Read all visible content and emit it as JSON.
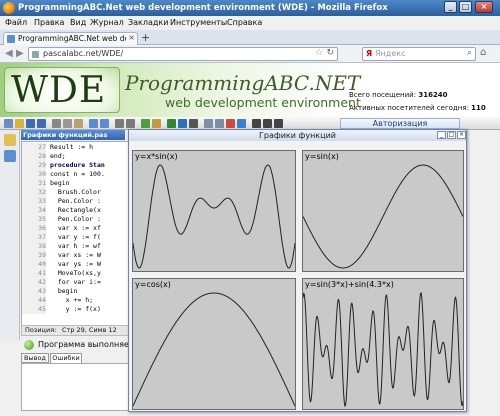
{
  "browser": {
    "title": "ProgrammingABC.Net web development environment (WDE) - Mozilla Firefox",
    "menu": [
      "Файл",
      "Правка",
      "Вид",
      "Журнал",
      "Закладки",
      "Инструменты",
      "Справка"
    ],
    "tab_title": "ProgrammingABC.Net web develo...",
    "new_tab": "+",
    "url": "pascalabc.net/WDE/",
    "search_engine": "Яндекс"
  },
  "header": {
    "logo": "WDE",
    "brand": "ProgrammingABC.NET",
    "subbrand": "web development environment",
    "visits_label": "Всего посещений:",
    "visits_value": "316240",
    "active_label": "Активных посетителей сегодня:",
    "active_value": "110"
  },
  "ide": {
    "file_tab": "Графики функций.pas",
    "auth_button": "Авторизация",
    "code_lines": [
      {
        "n": "27",
        "t": "Result := h",
        "bold": false
      },
      {
        "n": "28",
        "t": "end;",
        "bold": false
      },
      {
        "n": "29",
        "t": "procedure Stan",
        "bold": true
      },
      {
        "n": "30",
        "t": "const n = 100.",
        "bold": false
      },
      {
        "n": "31",
        "t": "begin",
        "bold": false
      },
      {
        "n": "32",
        "t": "  Brush.Color",
        "bold": false
      },
      {
        "n": "33",
        "t": "  Pen.Color :",
        "bold": false
      },
      {
        "n": "34",
        "t": "  Rectangle(x",
        "bold": false
      },
      {
        "n": "35",
        "t": "  Pen.Color :",
        "bold": false
      },
      {
        "n": "36",
        "t": "  var x := xf",
        "bold": false
      },
      {
        "n": "37",
        "t": "  var y := f(",
        "bold": false
      },
      {
        "n": "38",
        "t": "  var h := wf",
        "bold": false
      },
      {
        "n": "39",
        "t": "  var xs := W",
        "bold": false
      },
      {
        "n": "40",
        "t": "  var ys := W",
        "bold": false
      },
      {
        "n": "41",
        "t": "  MoveTo(xs,y",
        "bold": false
      },
      {
        "n": "42",
        "t": "  for var i:=",
        "bold": false
      },
      {
        "n": "43",
        "t": "  begin",
        "bold": false
      },
      {
        "n": "44",
        "t": "    x += h;",
        "bold": false
      },
      {
        "n": "45",
        "t": "    y := f(x)",
        "bold": false
      }
    ],
    "position_label": "Позиция:",
    "position_value": "Стр 29, Симв 12",
    "run_status": "Программа выполняется",
    "output_tabs": [
      "Вывод",
      "Ошибки"
    ]
  },
  "graph_window": {
    "title": "Графики функций",
    "buttons": [
      "_",
      "□",
      "×"
    ]
  },
  "chart_data": [
    {
      "type": "line",
      "title": "y=x*sin(x)",
      "function": "x*sin(x)",
      "grid": false
    },
    {
      "type": "line",
      "title": "y=sin(x)",
      "function": "sin(x)",
      "grid": false
    },
    {
      "type": "line",
      "title": "y=cos(x)",
      "function": "cos(x)",
      "grid": false
    },
    {
      "type": "line",
      "title": "y=sin(3*x)+sin(4.3*x)",
      "function": "sin(3*x)+sin(4.3*x)",
      "grid": false
    }
  ],
  "colors": {
    "plot_bg": "#c9c9c9",
    "curve": "#222222",
    "banner_green": "#3d6e26",
    "title_blue": "#2b5f9e"
  }
}
